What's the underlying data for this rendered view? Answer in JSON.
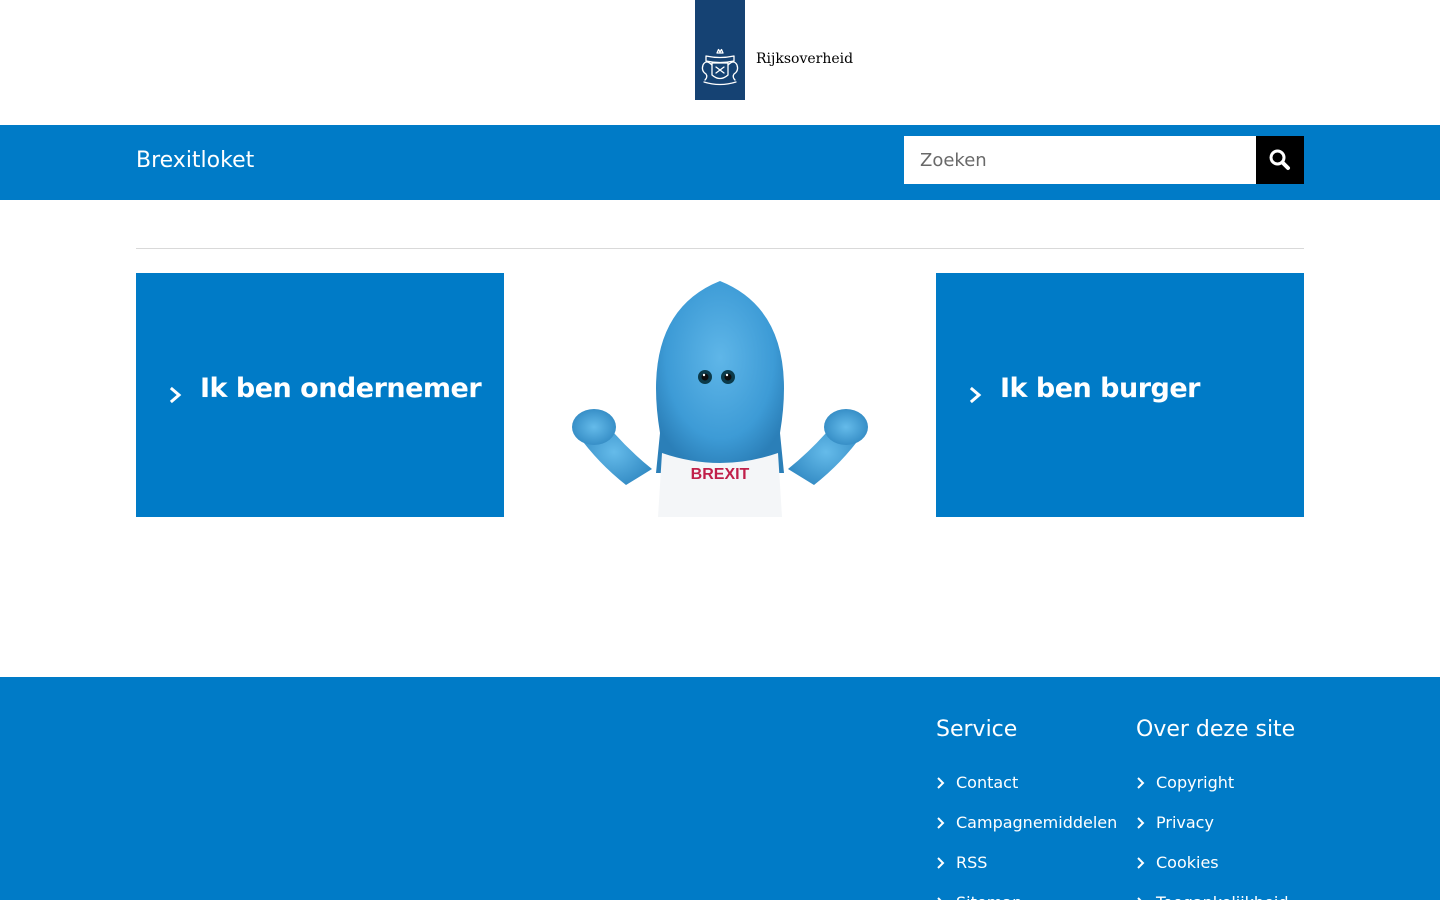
{
  "header": {
    "logo_text": "Rijksoverheid",
    "site_title": "Brexitloket"
  },
  "search": {
    "placeholder": "Zoeken",
    "button_label": "Zoeken",
    "button_icon": "search-icon"
  },
  "tiles": [
    {
      "label": "Ik ben ondernemer",
      "icon": "chevron-right-icon"
    },
    {
      "label": "Ik ben burger",
      "icon": "chevron-right-icon"
    }
  ],
  "mascot": {
    "shirt_text": "BREXIT"
  },
  "footer": {
    "columns": [
      {
        "heading": "Service",
        "links": [
          "Contact",
          "Campagnemiddelen",
          "RSS",
          "Sitemap"
        ]
      },
      {
        "heading": "Over deze site",
        "links": [
          "Copyright",
          "Privacy",
          "Cookies",
          "Toegankelijkheid"
        ]
      }
    ]
  },
  "colors": {
    "brand_blue": "#007bc7",
    "logo_blue": "#154273",
    "search_button": "#000000",
    "mascot_shirt_text": "#c0204a"
  }
}
